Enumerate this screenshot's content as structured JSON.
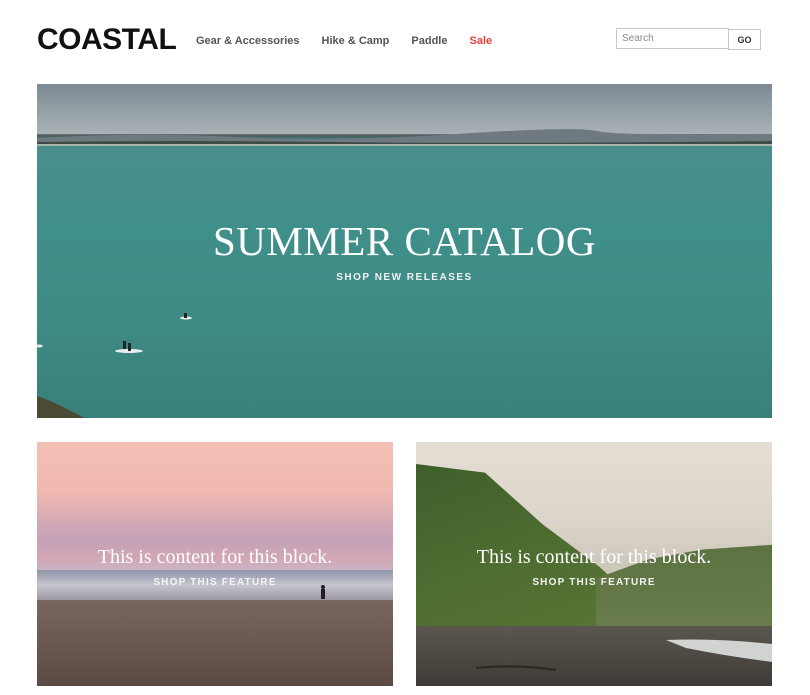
{
  "brand": {
    "logo": "COASTAL"
  },
  "nav": {
    "items": [
      {
        "label": "Gear & Accessories"
      },
      {
        "label": "Hike & Camp"
      },
      {
        "label": "Paddle"
      },
      {
        "label": "Sale"
      }
    ]
  },
  "search": {
    "placeholder": "Search",
    "button_label": "GO"
  },
  "hero": {
    "title": "SUMMER CATALOG",
    "cta": "SHOP NEW RELEASES"
  },
  "features": [
    {
      "title": "This is content for this block.",
      "cta": "SHOP THIS FEATURE"
    },
    {
      "title": "This is content for this block.",
      "cta": "SHOP THIS FEATURE"
    }
  ],
  "colors": {
    "sale": "#e0413a",
    "text": "#111111",
    "nav": "#555555"
  }
}
